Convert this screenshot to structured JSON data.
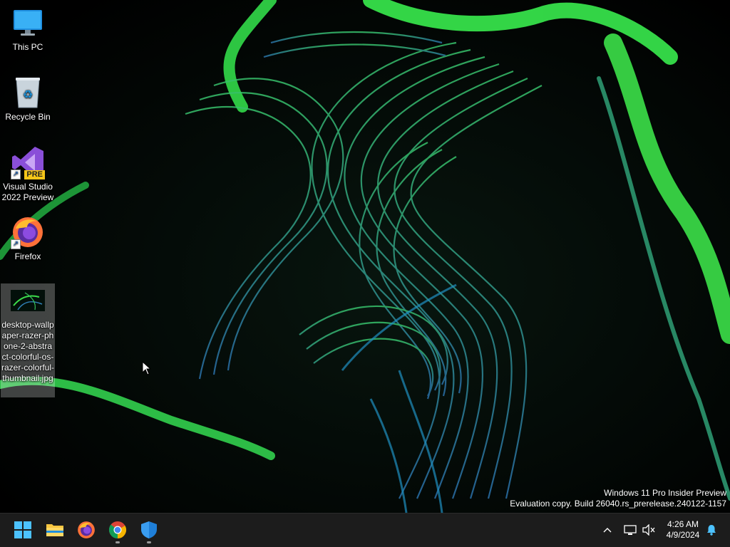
{
  "desktop": {
    "icons": [
      {
        "label": "This PC",
        "icon": "monitor-icon"
      },
      {
        "label": "Recycle Bin",
        "icon": "recycle-bin-icon"
      },
      {
        "label": "Visual Studio 2022 Preview",
        "icon": "visual-studio-icon",
        "badge": "PRE"
      },
      {
        "label": "Firefox",
        "icon": "firefox-icon"
      },
      {
        "label": "desktop-wallpaper-razer-phone-2-abstract-colorful-os-razer-colorful-thumbnail.jpg",
        "icon": "image-file-icon",
        "selected": true
      }
    ],
    "watermark": {
      "line1": "Windows 11 Pro Insider Preview",
      "line2": "Evaluation copy. Build 26040.rs_prerelease.240122-1157"
    }
  },
  "taskbar": {
    "apps": [
      "start-icon",
      "file-explorer-icon",
      "firefox-icon",
      "chrome-icon",
      "windows-security-icon"
    ],
    "tray": {
      "time": "4:26 AM",
      "date": "4/9/2024"
    }
  },
  "colors": {
    "taskbar_bg": "#1c1c1c",
    "wallpaper_green": "#3ddc4a",
    "wallpaper_blue": "#2f7fb5"
  }
}
